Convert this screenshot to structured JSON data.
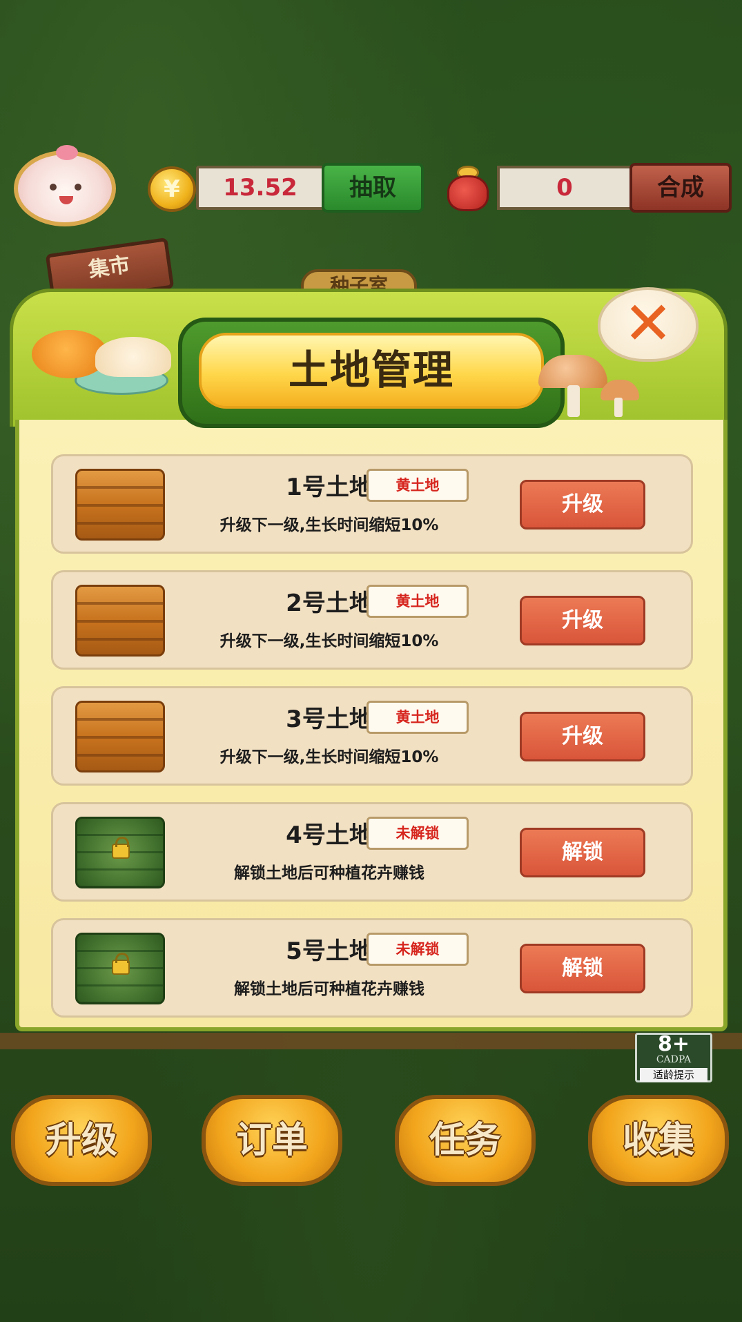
{
  "hud": {
    "coin_symbol": "¥",
    "money": "13.52",
    "draw_label": "抽取",
    "bag_count": "0",
    "merge_label": "合成"
  },
  "background": {
    "market_sign": "集市",
    "seed_room_sign": "种子室"
  },
  "modal": {
    "title": "土地管理",
    "close_symbol": "✕",
    "cards": [
      {
        "name": "1号土地",
        "tag": "黄土地",
        "desc": "升级下一级,生长时间缩短10%",
        "action": "升级",
        "locked": false
      },
      {
        "name": "2号土地",
        "tag": "黄土地",
        "desc": "升级下一级,生长时间缩短10%",
        "action": "升级",
        "locked": false
      },
      {
        "name": "3号土地",
        "tag": "黄土地",
        "desc": "升级下一级,生长时间缩短10%",
        "action": "升级",
        "locked": false
      },
      {
        "name": "4号土地",
        "tag": "未解锁",
        "desc": "解锁土地后可种植花卉赚钱",
        "action": "解锁",
        "locked": true
      },
      {
        "name": "5号土地",
        "tag": "未解锁",
        "desc": "解锁土地后可种植花卉赚钱",
        "action": "解锁",
        "locked": true
      }
    ]
  },
  "age_rating": {
    "age": "8+",
    "org": "CADPA",
    "tip": "适龄提示"
  },
  "bottom_nav": [
    "升级",
    "订单",
    "任务",
    "收集"
  ],
  "colors": {
    "action_button": "#e0623f",
    "tag_text": "#d6261e",
    "money_text": "#c8283a",
    "panel_bg": "#fbf1b6"
  }
}
